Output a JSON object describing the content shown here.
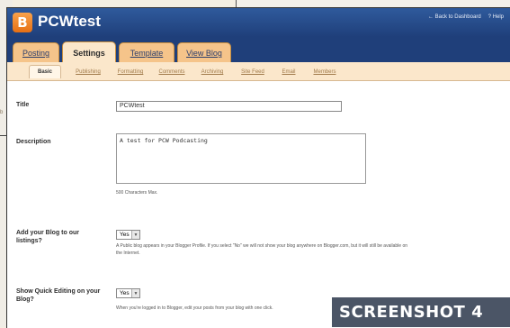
{
  "background": {
    "fragment_text": "b"
  },
  "header": {
    "blog_title": "PCWtest",
    "links": [
      "← Back to Dashboard",
      "? Help"
    ]
  },
  "tabs": [
    {
      "label": "Posting",
      "active": false
    },
    {
      "label": "Settings",
      "active": true
    },
    {
      "label": "Template",
      "active": false
    },
    {
      "label": "View Blog",
      "active": false
    }
  ],
  "subtabs": [
    {
      "label": "Basic",
      "active": true
    },
    {
      "label": "Publishing",
      "active": false
    },
    {
      "label": "Formatting",
      "active": false
    },
    {
      "label": "Comments",
      "active": false
    },
    {
      "label": "Archiving",
      "active": false
    },
    {
      "label": "Site Feed",
      "active": false
    },
    {
      "label": "Email",
      "active": false
    },
    {
      "label": "Members",
      "active": false
    }
  ],
  "form": {
    "title_label": "Title",
    "title_value": "PCWtest",
    "description_label": "Description",
    "description_value": "A test for PCW Podcasting",
    "description_hint": "500 Characters Max.",
    "add_blog_label": "Add your Blog to our listings?",
    "add_blog_value": "Yes",
    "add_blog_hint": "A Public blog appears in your Blogger Profile. If you select \"No\" we will not show your blog anywhere on Blogger.com, but it will still be available on the Internet.",
    "quick_edit_label": "Show Quick Editing on your Blog?",
    "quick_edit_value": "Yes",
    "quick_edit_hint": "When you're logged in to Blogger, edit your posts from your blog with one click."
  },
  "caption": "SCREENSHOT 4"
}
